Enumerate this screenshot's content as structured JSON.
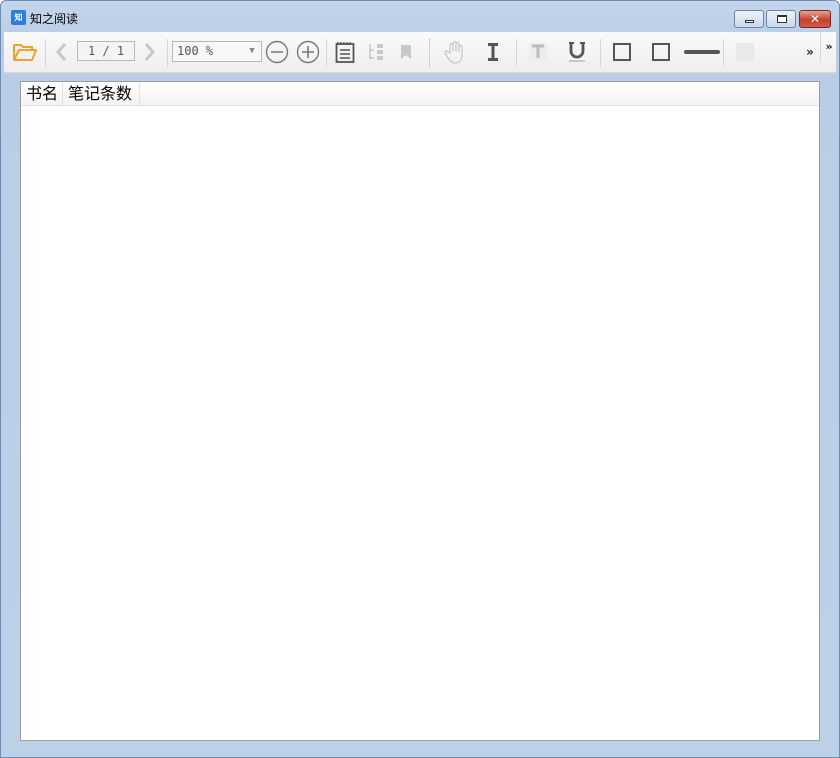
{
  "window": {
    "title": "知之阅读",
    "app_icon_text": "知",
    "close_glyph": "✕"
  },
  "toolbar": {
    "page_indicator": "1 / 1",
    "zoom_value": "100 %",
    "zoom_arrow": "▼",
    "overflow_glyph": "»",
    "overflow_glyph_2": "»"
  },
  "notes_table": {
    "columns": [
      "书名",
      "笔记条数"
    ],
    "rows": []
  },
  "colors": {
    "open_folder": "#f0a030",
    "icon_dark": "#555555",
    "icon_disabled": "#c8c8c8",
    "title_bar": "#c4d6ec",
    "close_button": "#c4412b"
  }
}
